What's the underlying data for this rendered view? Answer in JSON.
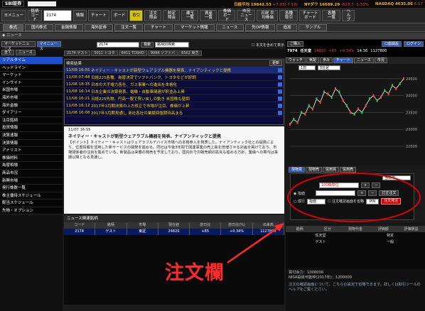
{
  "top": {
    "logo": "SBI証券",
    "indices": [
      {
        "label": "日経平均",
        "value": "19842.53",
        "change": "+7.03(-7.19)"
      },
      {
        "label": "NYダウ",
        "value": "16689.29",
        "change": "-623.7 -1.33%"
      },
      {
        "label": "NASDAQ",
        "value": "4635.06",
        "change": "6.17"
      }
    ]
  },
  "toolbar": {
    "menu": "メニュー",
    "code_label": "銘柄コード",
    "code": "2174",
    "btns": [
      "情報",
      "チャート",
      "ボード",
      "取引"
    ],
    "right_btns": [
      "注文 照会",
      "約定 照会",
      "建玉 一覧",
      "資産 一覧",
      "株価 ボード",
      "市況 ニュース",
      "日経 平均株価",
      "各種 取引",
      "チャート ボード",
      "各種 一覧",
      "ヘルプ"
    ]
  },
  "tabs": {
    "labels": [
      "株式",
      "国内株式",
      "金銭情報",
      "海外証券",
      "注文一覧",
      "チャート",
      "マーケット情報",
      "ニュース",
      "先OP情報",
      "追加",
      "サンプル"
    ]
  },
  "window_title": "ニュース",
  "news": {
    "title_a": "マーケットニュース",
    "title_b": "マイニュース",
    "code": "2174",
    "search_btn": "検索",
    "type": "銘柄別検索",
    "checkbox": "本文を含めて表示",
    "tickers": [
      "2174 ゲスト",
      "5011 トヨタ",
      "8411 TOSHO",
      "9984 ソフトバ",
      "6502 東芝"
    ],
    "list_header": "検索結果",
    "update_btn": "更新",
    "items": [
      {
        "date": "11/08",
        "time": "16:55",
        "title": "ネイティー・キャストが新型ウェアラブル機器を発表、ナイアンティックと提携"
      },
      {
        "date": "11/08",
        "time": "07:48",
        "title": "日経225各種、為替決済でソフトバンク、トヨタなどが好調"
      },
      {
        "date": "11/08",
        "time": "18:15",
        "title": "日本の大手電力各社、ガス事業への進出を本格化"
      },
      {
        "date": "11/08",
        "time": "16:14",
        "title": "日本企業の決算発表、電機・自動車関連が軒並み上昇"
      },
      {
        "date": "11/08",
        "time": "16:21",
        "title": "日経225先物、円高一服で買い戻しの動き 米国株も堅調"
      },
      {
        "date": "11/08",
        "time": "16:12",
        "title": "2017年3月期決算の上方修正で市場が注目、株価が上昇"
      },
      {
        "date": "11/08",
        "time": "16:08",
        "title": "2017年3月期見通し 商社各社の業績回復期待高まる"
      }
    ],
    "article_date": "11/07 16:55",
    "article_title": "ネイティー・キャストが新型ウェアラブル機器を発表、ナイアンティックと提携",
    "article_body": "【ポイント】ネイティー・キャストはウェアラブルデバイス市場への本格参入を発表した。ナイアンティック社との提携により、位置情報を活用した新サービスの開発を進める。同社は今後3年間で関連事業の売上高を倍増させる計画を掲げており、市場関係者の注目を集めている。新製品は来春の発売を予定しており、国内外での販売網の拡充も進める方針。業績への寄与は来期以降となる見通し。"
  },
  "left_nav": {
    "items": [
      "リアルタイム",
      "ヘッドライン",
      "マーケット",
      "インサイト",
      "米国市場",
      "海外市場",
      "海外金融",
      "ダイアリー",
      "注目銘柄",
      "投資情報",
      "決算速報",
      "決算情報",
      "アナリスト",
      "株価材料",
      "為替相場",
      "商品市況",
      "新興市場",
      "発行株数一覧",
      "株主優待スケジュール",
      "配当スケジュール",
      "先物・オプション"
    ],
    "btn_a": "全て",
    "btn_b": "ニュース"
  },
  "related": {
    "title": "ニュース関連銘柄",
    "headers": [
      "コード",
      "銘柄",
      "市場",
      "現在値",
      "前日比",
      "前日比(%)",
      "出来高"
    ],
    "rows": [
      [
        "2174",
        "ゲスト",
        "東証",
        "24820",
        "+85",
        "+0.34%",
        "1127800"
      ]
    ]
  },
  "quote": {
    "name": "任天堂",
    "code": "7974",
    "price": "24820",
    "change": "+85",
    "percent": "+0.34%",
    "time": "14:36",
    "volume": "1127800",
    "login_btn": "ご購入",
    "btns": [
      "口座開設",
      "ログイン"
    ],
    "tabs": [
      "ウォッチ",
      "気配",
      "歩み",
      "チャート",
      "ニュース",
      "市況"
    ]
  },
  "chart_data": {
    "type": "line",
    "y_ticks": [
      24500,
      24000,
      23500,
      23000,
      22500
    ],
    "values": [
      23150,
      23300,
      23200,
      23500,
      23450,
      23700,
      23600,
      23900,
      23800,
      24100,
      24050,
      23950,
      24200,
      24100,
      23850,
      23700,
      23500,
      23450,
      23600,
      23500,
      23700,
      23900,
      24000,
      23850,
      23950,
      24150,
      24050,
      24300,
      24200,
      24350,
      24500
    ],
    "period": "1日",
    "interval": "5分足"
  },
  "order": {
    "tabs": [
      "現物買",
      "現物売",
      "信用買",
      "信用売"
    ],
    "market": "当日中",
    "qty_label": "100株単位",
    "radio_a": "指値",
    "radio_b": "成行",
    "price_type": "指値",
    "check": "注文確認画面を省略",
    "submit": "注文発注",
    "btn_b": "訂正注文",
    "limit": "PIN"
  },
  "lower": {
    "headers": [
      "銘柄",
      "区分",
      "現物代金",
      "評価額",
      "評価損益"
    ],
    "rows": [
      [
        "任天堂",
        "特定"
      ],
      [
        "ゲスト",
        "一般"
      ]
    ]
  },
  "info": {
    "line1": "買付余力：1000000",
    "line2": "NISA投資可能枠(2017年)：1200000",
    "line3": "注文の確認画面について、こちらの設定で省略できます。詳しくは取引ツールのヘルプをご覧ください。"
  },
  "callout": "注文欄",
  "colors": {
    "accent": "#1e4fd0",
    "callout": "#ff2a2a",
    "order_outline": "#e00000"
  }
}
